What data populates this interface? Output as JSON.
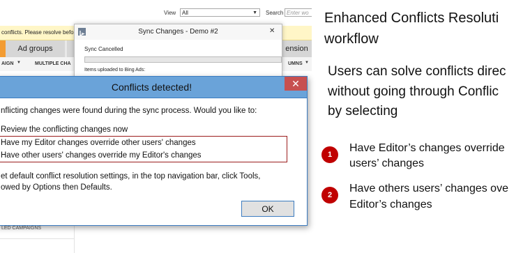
{
  "app": {
    "view_label": "View",
    "view_value": "All",
    "search_label": "Search",
    "search_placeholder": "Enter wo",
    "warning_text": "conflicts. Please resolve before",
    "tabs": [
      "",
      "Ad groups",
      "",
      "ension"
    ],
    "subnav": [
      "AIGN",
      "MULTIPLE CHA",
      "UMNS"
    ],
    "bottom_text": "LED CAMPAIGNS"
  },
  "sync_window": {
    "title": "Sync Changes - Demo #2",
    "status": "Sync Cancelled",
    "uploaded_label": "Items uploaded to Bing Ads:"
  },
  "dialog": {
    "title": "Conflicts detected!",
    "close_label": "✕",
    "intro": "nflicting changes were found during the sync process. Would you like to:",
    "options": [
      "Review the conflicting changes now",
      "Have my Editor changes override other users' changes",
      "Have other users' changes override my Editor's changes"
    ],
    "note_line1": "et default conflict resolution settings, in the top navigation bar, click Tools,",
    "note_line2": "owed by Options then Defaults.",
    "ok_label": "OK"
  },
  "annotation": {
    "heading_line1": "Enhanced Conflicts Resoluti",
    "heading_line2": "workflow",
    "desc_line1": "Users can solve conflicts direc",
    "desc_line2": "without going through Conflic",
    "desc_line3": "by selecting",
    "items": [
      {
        "badge": "1",
        "line1": "Have Editor’s changes override",
        "line2": "users’ changes"
      },
      {
        "badge": "2",
        "line1": "Have others users’ changes ove",
        "line2": "Editor’s changes"
      }
    ],
    "badge_color": "#c00000"
  }
}
